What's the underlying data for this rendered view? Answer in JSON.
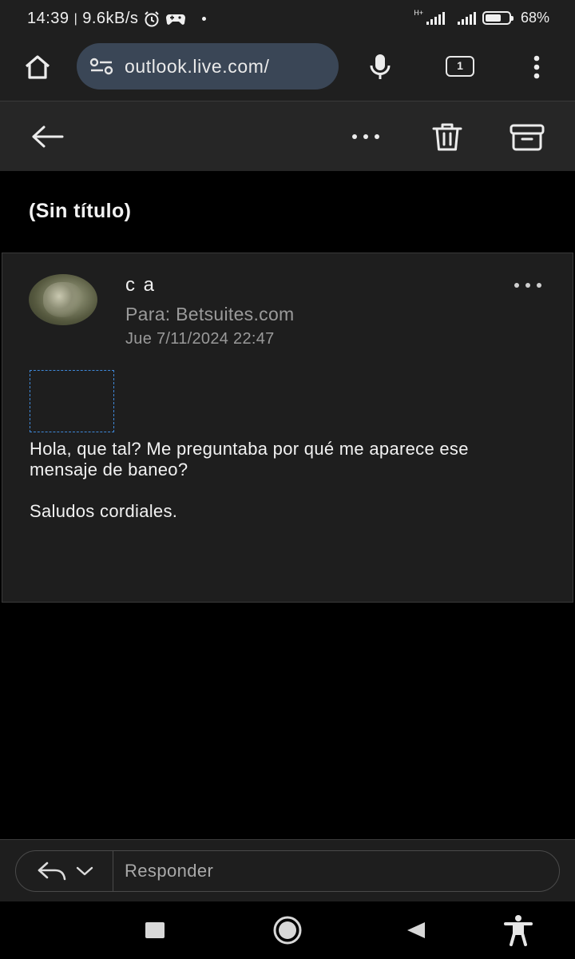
{
  "status_bar": {
    "time": "14:39",
    "separator": "|",
    "speed": "9.6kB/s",
    "network_type": "H+",
    "battery": "68%",
    "battery_level": 0.68
  },
  "browser": {
    "url": "outlook.live.com/",
    "tab_count": "1",
    "icons": [
      "home-icon",
      "site-info-icon",
      "microphone-icon",
      "tabs-icon",
      "overflow-menu-icon"
    ]
  },
  "mail_toolbar": {
    "icons": [
      "back-arrow-icon",
      "more-options-icon",
      "delete-icon",
      "archive-icon"
    ]
  },
  "email": {
    "subject": "(Sin título)",
    "sender": "c a",
    "to": "Para: Betsuites.com",
    "date": "Jue 7/11/2024 22:47",
    "body": [
      "Hola, que tal? Me preguntaba por qué me aparece ese mensaje de baneo?",
      "Saludos cordiales."
    ]
  },
  "reply": {
    "placeholder": "Responder"
  },
  "colors": {
    "toolbar": "#262626",
    "card": "#1e1e1e",
    "url_pill": "#3a4656",
    "placeholder_border": "#3f88d8",
    "muted_text": "#9a9a9a"
  }
}
